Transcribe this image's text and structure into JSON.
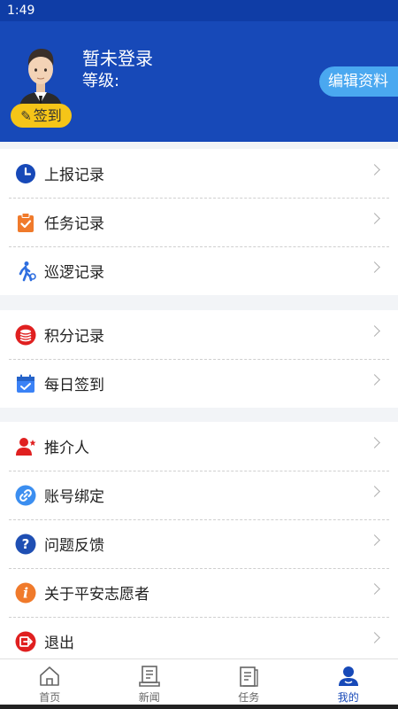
{
  "status": {
    "time": "1:49"
  },
  "profile": {
    "name": "暂未登录",
    "level": "等级:",
    "signin": "签到",
    "edit": "编辑资料"
  },
  "menu": {
    "group1": [
      {
        "label": "上报记录",
        "icon": "clock-icon"
      },
      {
        "label": "任务记录",
        "icon": "task-clipboard-icon"
      },
      {
        "label": "巡逻记录",
        "icon": "patrol-walk-icon"
      }
    ],
    "group2": [
      {
        "label": "积分记录",
        "icon": "points-coins-icon"
      },
      {
        "label": "每日签到",
        "icon": "calendar-check-icon"
      }
    ],
    "group3": [
      {
        "label": "推介人",
        "icon": "referrer-user-icon"
      },
      {
        "label": "账号绑定",
        "icon": "link-icon"
      },
      {
        "label": "问题反馈",
        "icon": "question-icon"
      },
      {
        "label": "关于平安志愿者",
        "icon": "info-icon"
      },
      {
        "label": "退出",
        "icon": "logout-icon"
      }
    ]
  },
  "tabs": [
    {
      "label": "首页",
      "icon": "home-icon"
    },
    {
      "label": "新闻",
      "icon": "news-icon"
    },
    {
      "label": "任务",
      "icon": "task-icon"
    },
    {
      "label": "我的",
      "icon": "profile-icon"
    }
  ],
  "colors": {
    "header": "#1749b8",
    "accent": "#4aa8f0",
    "signin": "#f5c518"
  }
}
